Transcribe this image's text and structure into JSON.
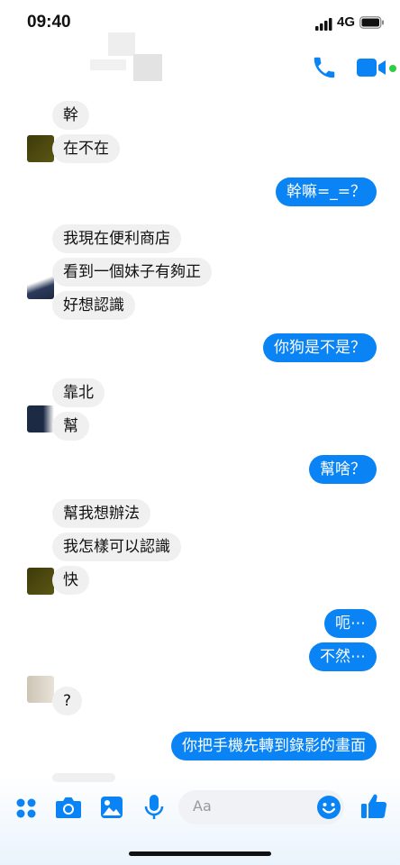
{
  "status_bar": {
    "time": "09:40",
    "network": "4G"
  },
  "header": {
    "call_icon": "phone-icon",
    "video_icon": "video-camera-icon",
    "accent_color": "#0a84f4",
    "online_color": "#31cc46"
  },
  "messages": [
    {
      "side": "in",
      "text": "幹"
    },
    {
      "side": "in",
      "text": "在不在"
    },
    {
      "side": "out",
      "text": "幹嘛=_=？"
    },
    {
      "side": "in",
      "text": "我現在便利商店"
    },
    {
      "side": "in",
      "text": "看到一個妹子有夠正"
    },
    {
      "side": "in",
      "text": "好想認識"
    },
    {
      "side": "out",
      "text": "你狗是不是？"
    },
    {
      "side": "in",
      "text": "靠北"
    },
    {
      "side": "in",
      "text": "幫"
    },
    {
      "side": "out",
      "text": "幫啥？"
    },
    {
      "side": "in",
      "text": "幫我想辦法"
    },
    {
      "side": "in",
      "text": "我怎樣可以認識"
    },
    {
      "side": "in",
      "text": "快"
    },
    {
      "side": "out",
      "text": "呃⋯"
    },
    {
      "side": "out",
      "text": "不然⋯"
    },
    {
      "side": "in",
      "text": "?"
    },
    {
      "side": "out",
      "text": "你把手機先轉到錄影的畫面"
    }
  ],
  "composer": {
    "placeholder": "Aa",
    "icons": [
      "menu-dots-icon",
      "camera-icon",
      "image-icon",
      "microphone-icon",
      "emoji-icon",
      "thumbs-up-icon"
    ]
  }
}
